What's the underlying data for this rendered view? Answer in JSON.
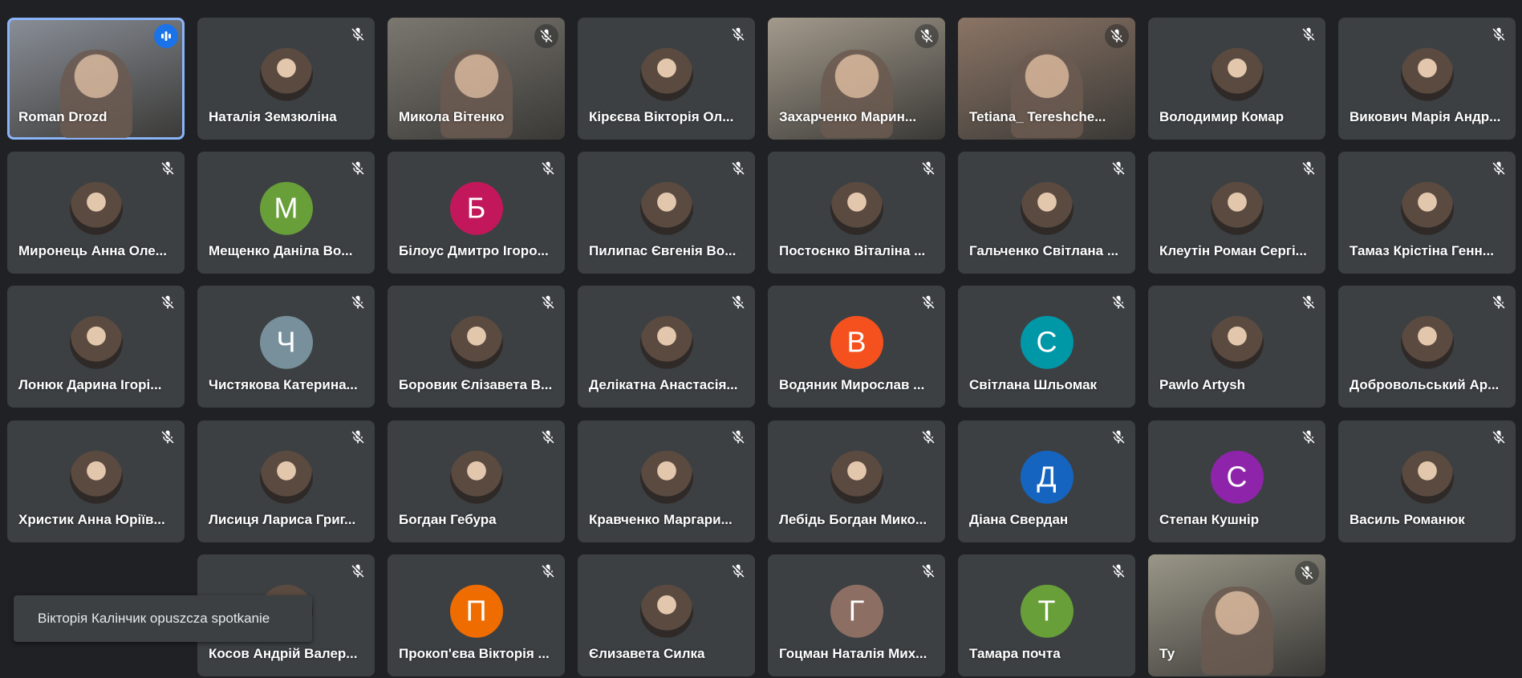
{
  "app": "Google Meet",
  "participants": [
    {
      "name": "Roman Drozd",
      "type": "video",
      "speaking": true,
      "muted": false,
      "bg": "#8a8f98"
    },
    {
      "name": "Наталія Земзюліна",
      "type": "photo",
      "muted": true
    },
    {
      "name": "Микола Вітенко",
      "type": "video",
      "muted": true,
      "bg": "#7b7770"
    },
    {
      "name": "Кірєєва Вікторія Ол...",
      "type": "photo",
      "muted": true
    },
    {
      "name": "Захарченко Марин...",
      "type": "video",
      "muted": true,
      "bg": "#a39a8c"
    },
    {
      "name": "Tetiana_ Tereshche...",
      "type": "video",
      "muted": true,
      "bg": "#8b7465"
    },
    {
      "name": "Володимир Комар",
      "type": "photo",
      "muted": true
    },
    {
      "name": "Викович Марія Андр...",
      "type": "photo",
      "muted": true
    },
    {
      "name": "Миронець Анна Оле...",
      "type": "photo",
      "muted": true
    },
    {
      "name": "Мещенко Даніла Во...",
      "type": "initial",
      "initial": "М",
      "color": "#689f38",
      "muted": true
    },
    {
      "name": "Білоус Дмитро Ігоро...",
      "type": "initial",
      "initial": "Б",
      "color": "#c2185b",
      "muted": true
    },
    {
      "name": "Пилипас Євгенія Во...",
      "type": "photo",
      "muted": true
    },
    {
      "name": "Постоєнко Віталіна ...",
      "type": "photo",
      "muted": true
    },
    {
      "name": "Гальченко Світлана ...",
      "type": "photo",
      "muted": true
    },
    {
      "name": "Клеутін Роман Сергі...",
      "type": "photo",
      "muted": true
    },
    {
      "name": "Тамаз Крістіна Генн...",
      "type": "photo",
      "muted": true
    },
    {
      "name": "Лонюк Дарина Ігорі...",
      "type": "photo",
      "muted": true
    },
    {
      "name": "Чистякова Катерина...",
      "type": "initial",
      "initial": "Ч",
      "color": "#78909c",
      "muted": true
    },
    {
      "name": "Боровик Єлізавета В...",
      "type": "photo",
      "muted": true
    },
    {
      "name": "Делікатна Анастасія...",
      "type": "photo",
      "muted": true
    },
    {
      "name": "Водяник Мирослав ...",
      "type": "initial",
      "initial": "В",
      "color": "#f4511e",
      "muted": true
    },
    {
      "name": "Світлана Шльомак",
      "type": "initial",
      "initial": "С",
      "color": "#0097a7",
      "muted": true
    },
    {
      "name": "Pawlo Artysh",
      "type": "photo",
      "muted": true
    },
    {
      "name": "Добровольський Ар...",
      "type": "photo",
      "muted": true
    },
    {
      "name": "Христик Анна Юріїв...",
      "type": "photo",
      "muted": true
    },
    {
      "name": "Лисиця Лариса Григ...",
      "type": "photo",
      "muted": true
    },
    {
      "name": "Богдан Гебура",
      "type": "photo",
      "muted": true
    },
    {
      "name": "Кравченко Маргари...",
      "type": "photo",
      "muted": true
    },
    {
      "name": "Лебідь Богдан Мико...",
      "type": "photo",
      "muted": true
    },
    {
      "name": "Діана Свердан",
      "type": "initial",
      "initial": "Д",
      "color": "#1565c0",
      "muted": true
    },
    {
      "name": "Степан Кушнір",
      "type": "initial",
      "initial": "С",
      "color": "#8e24aa",
      "muted": true
    },
    {
      "name": "Василь Романюк",
      "type": "photo",
      "muted": true
    },
    {
      "name": "Косов Андрій Валер...",
      "type": "photo",
      "muted": true
    },
    {
      "name": "Прокоп'єва Вікторія ...",
      "type": "initial",
      "initial": "П",
      "color": "#ef6c00",
      "muted": true
    },
    {
      "name": "Єлизавета Силка",
      "type": "photo",
      "muted": true
    },
    {
      "name": "Гоцман Наталія Мих...",
      "type": "initial",
      "initial": "Г",
      "color": "#8d6e63",
      "muted": true
    },
    {
      "name": "Тамара почта",
      "type": "initial",
      "initial": "Т",
      "color": "#689f38",
      "muted": true
    },
    {
      "name": "Ту",
      "type": "video",
      "muted": true,
      "bg": "#9a9788"
    }
  ],
  "toast": {
    "text": "Вікторія Калінчик opuszcza spotkanie"
  }
}
